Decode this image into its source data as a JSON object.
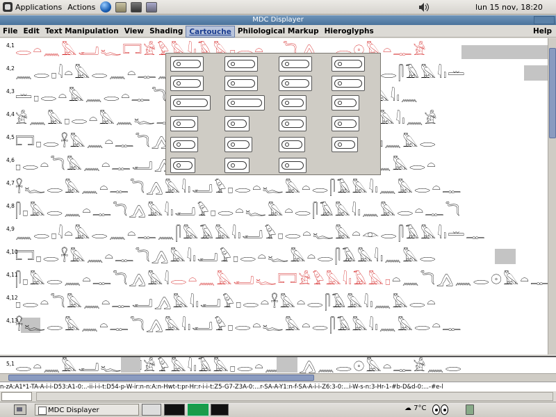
{
  "top_panel": {
    "applications": "Applications",
    "actions": "Actions",
    "clock": "lun 15 nov, 18:20"
  },
  "window": {
    "title": "MDC Displayer",
    "menu": [
      {
        "label": "File"
      },
      {
        "label": "Edit"
      },
      {
        "label": "Text Manipulation"
      },
      {
        "label": "View"
      },
      {
        "label": "Shading"
      },
      {
        "label": "Cartouche"
      },
      {
        "label": "Philological Markup"
      },
      {
        "label": "Hieroglyphs"
      },
      {
        "label": "Help"
      }
    ],
    "active_menu": "Cartouche"
  },
  "document": {
    "lines": [
      {
        "num": "4,1",
        "glyphs": "𓂋𓏏𓈖𓅓𓂝𓆑𓉐𓀀𓅱𓅓𓇋𓏤𓄿𓅓𓊪𓂋𓏏𓈖𓆓𓂻𓈖𓂋𓇳𓅓𓏏𓊃𓀀"
      },
      {
        "num": "4,2",
        "glyphs": "𓈖𓂋𓊪𓇋𓏏𓅓𓂋𓈖𓏏𓊃𓈖𓋴𓅓𓄿𓅓𓇋𓏤𓂝𓅱𓊪𓂋𓏏𓆑𓅓𓏏𓁹𓂋𓋴𓄿𓅓𓇋𓏤𓏛"
      },
      {
        "num": "4,3",
        "glyphs": "𓏛𓊪𓂋𓏏𓅓𓈖𓂋𓏏𓊃𓆓𓂻𓅓𓇋𓏤𓂝𓅱𓊪𓂋𓏏𓆑𓅓𓏏𓂋𓋴𓄿𓅓𓇋𓏤𓈖"
      },
      {
        "num": "4,4",
        "glyphs": "𓀀𓈖𓅓𓊪𓂋𓏏𓅓𓈖𓆑𓊃𓄿𓅓𓇋𓏤𓂝𓅱𓊪𓂋𓏏𓆑𓅓𓏏𓂋𓋴𓄿𓅓𓇋𓏤𓈖𓀀"
      },
      {
        "num": "4,5",
        "glyphs": "𓉐𓊪𓂋𓋹𓅓𓈖𓏏𓊃𓆓𓂻𓅓𓇋𓏤𓂝𓅱𓊪𓂋𓏏𓆑𓅓𓏏𓂋𓋴𓄿𓅓𓇋𓏤𓈖𓅓𓂋"
      },
      {
        "num": "4,6",
        "glyphs": "𓊪𓂋𓏏𓆓𓅓𓈖𓏏𓊃𓂝𓂻𓅓𓇋𓏤𓂝𓅱𓊪𓂋𓏏𓋹𓅓𓏏𓂋𓋴𓄿𓅓𓇋𓏤𓈖𓅓𓂋𓏏"
      },
      {
        "num": "4,7",
        "glyphs": "𓋹𓆑𓂋𓅓𓈖𓏏𓊃𓆓𓂻𓅓𓇋𓏤𓂝𓅱𓊪𓂋𓏏𓆑𓅓𓏏𓂋𓋴𓄿𓅓𓇋𓏤𓈖𓅓𓂋𓏏𓊃"
      },
      {
        "num": "4,8",
        "glyphs": "𓋴𓊪𓅓𓂋𓈖𓏏𓊃𓆓𓂻𓅓𓇋𓏤𓂝𓅱𓊪𓂋𓏏𓆑𓅓𓏏𓂋𓋴𓄿𓅓𓇋𓏤𓈖𓅓𓂋𓏏𓊃𓆓"
      },
      {
        "num": "4,9",
        "glyphs": "𓈖𓂋𓊪𓇋𓏏𓅓𓂋𓈖𓏏𓊃𓈖𓋴𓅓𓄿𓅓𓇋𓏤𓂝𓅱𓊪𓂋𓏏𓆑𓅓𓏏𓁹𓂋𓋴𓄿𓅓𓇋𓏤𓏛𓊃"
      },
      {
        "num": "4,10",
        "glyphs": "𓉐𓊪𓂋𓋹𓅓𓈖𓏏𓊃𓆓𓂻𓅓𓇋𓏤𓂝𓅱𓊪𓂋𓏏𓆑𓅓𓏏𓂋𓋴𓄿𓅓𓇋𓏤𓈖𓅓𓂋"
      },
      {
        "num": "4,11",
        "glyphs_a": "𓋴𓊪𓅓𓂋𓈖𓏏𓊃𓆓𓂻𓅓𓇋",
        "glyphs_red": "𓂋𓏏𓈖𓅓𓂝𓆑𓉐𓀀𓅱𓅓𓇋𓏤𓄿𓅓𓊪",
        "glyphs_b": "𓏏𓈖𓆓𓂻𓈖𓂋𓇳𓅓𓏏𓊃𓀀"
      },
      {
        "num": "4,12",
        "glyphs": "𓊪𓂋𓏏𓆓𓅓𓈖𓏏𓊃𓂝𓂻𓅓𓇋𓏤𓂝𓅱𓊪𓂋𓏏𓋹𓅓𓏏𓂋𓋴𓄿𓅓𓇋𓏤𓈖𓅓𓂋𓏏"
      },
      {
        "num": "4,13",
        "glyphs": "𓋹𓆑𓂋𓅓𓈖𓏏𓊃𓆓𓂻𓅓𓇋𓏤𓂝𓅱𓊪𓂋𓏏𓆑𓅓𓏏𓂋𓋴𓄿𓅓𓇋𓏤𓈖𓅓𓂋𓏏𓊃"
      }
    ],
    "line_51": {
      "num": "5,1",
      "glyphs": "𓂋𓏏𓈖𓅓𓂝𓆑𓉐𓀀𓅱𓅓𓇋𓏤𓄿𓅓𓊪𓂋𓏏𓈖𓆓𓂻𓈖𓂋𓇳𓅓𓏏𓊃𓀀𓈖𓂋"
    }
  },
  "code_line": "n-zA:A1*1-TA-A-i-i-D53:A1-0:..-ii-i-i-t:D54-p-W-ir:n-n:A:n-Hwt-t:pr-Hr:r-i-i-t:Z5-G7-Z3A-0:...r-SA-A-Y1:n-f-SA-A-i-i-Z6:3-0:...i-W-s-n:3-Hr-1-#b-D&d-0:...-#e-l",
  "taskbar": {
    "task_label": "MDC Displayer",
    "weather": "7°C"
  }
}
